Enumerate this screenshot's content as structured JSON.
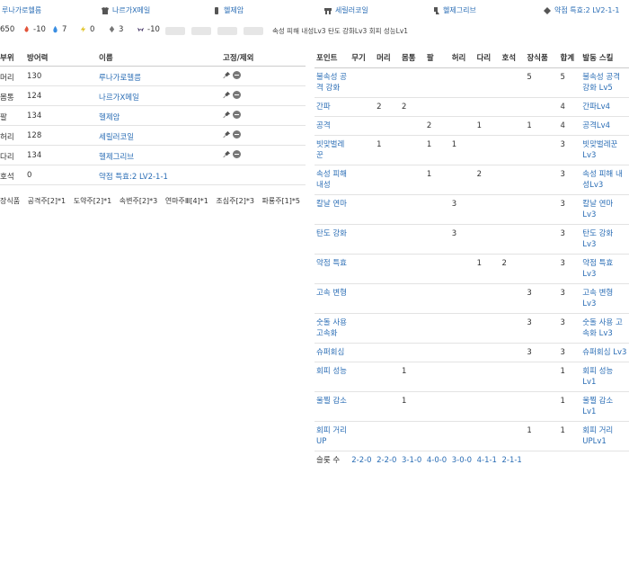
{
  "equipment": [
    {
      "icon": "helmet-icon",
      "name": "루나가로헬름"
    },
    {
      "icon": "chest-armor-icon",
      "name": "나르가X메일"
    },
    {
      "icon": "arm-guard-icon",
      "name": "헬제암"
    },
    {
      "icon": "waist-armor-icon",
      "name": "세릴러코일"
    },
    {
      "icon": "leg-armor-icon",
      "name": "헬제그리브"
    },
    {
      "icon": "charm-icon",
      "name": "약점 특효:2 LV2-1-1"
    }
  ],
  "stats": {
    "defense": "650",
    "fire": "-10",
    "water": "7",
    "thunder": "0",
    "ice": "3",
    "dragon": "-10"
  },
  "skills_summary": "속성 피해 내성Lv3  탄도 강화Lv3  회피 성능Lv1",
  "left_table": {
    "headers": {
      "part": "부위",
      "defense": "방어력",
      "name": "이름",
      "fix": "고정/제외"
    },
    "rows": [
      {
        "part": "머리",
        "defense": "130",
        "name": "루나가로헬름"
      },
      {
        "part": "몸통",
        "defense": "124",
        "name": "나르가X메일"
      },
      {
        "part": "팔",
        "defense": "134",
        "name": "헬제암"
      },
      {
        "part": "허리",
        "defense": "128",
        "name": "세릴러코일"
      },
      {
        "part": "다리",
        "defense": "134",
        "name": "헬제그리브"
      },
      {
        "part": "호석",
        "defense": "0",
        "name": "약점 특효:2 LV2-1-1"
      }
    ],
    "decorations_label": "장식품",
    "decorations": [
      "공격주[2]*1",
      "도약주[2]*1",
      "속변주[2]*3",
      "연마주Ⅲ[4]*1",
      "조심주[2]*3",
      "파룡주[1]*5"
    ]
  },
  "right_table": {
    "headers": [
      "포인트",
      "무기",
      "머리",
      "몸통",
      "팔",
      "허리",
      "다리",
      "호석",
      "장식품",
      "합계",
      "발동 스킬"
    ],
    "rows": [
      {
        "point": "불속성 공격 강화",
        "cells": [
          "",
          "",
          "",
          "",
          "",
          "",
          "",
          "5",
          "5"
        ],
        "skill": "불속성 공격 강화 Lv5"
      },
      {
        "point": "간파",
        "cells": [
          "",
          "2",
          "2",
          "",
          "",
          "",
          "",
          "",
          "4"
        ],
        "skill": "간파Lv4"
      },
      {
        "point": "공격",
        "cells": [
          "",
          "",
          "",
          "2",
          "",
          "1",
          "",
          "1",
          "4"
        ],
        "skill": "공격Lv4"
      },
      {
        "point": "빗맞벌레꾼",
        "cells": [
          "",
          "1",
          "",
          "1",
          "1",
          "",
          "",
          "",
          "3"
        ],
        "skill": "빗맞벌레꾼Lv3"
      },
      {
        "point": "속성 피해 내성",
        "cells": [
          "",
          "",
          "",
          "1",
          "",
          "2",
          "",
          "",
          "3"
        ],
        "skill": "속성 피해 내성Lv3"
      },
      {
        "point": "칼날 연마",
        "cells": [
          "",
          "",
          "",
          "",
          "3",
          "",
          "",
          "",
          "3"
        ],
        "skill": "칼날 연마 Lv3"
      },
      {
        "point": "탄도 강화",
        "cells": [
          "",
          "",
          "",
          "",
          "3",
          "",
          "",
          "",
          "3"
        ],
        "skill": "탄도 강화 Lv3"
      },
      {
        "point": "약점 특효",
        "cells": [
          "",
          "",
          "",
          "",
          "",
          "1",
          "2",
          "",
          "3"
        ],
        "skill": "약점 특효 Lv3"
      },
      {
        "point": "고속 변형",
        "cells": [
          "",
          "",
          "",
          "",
          "",
          "",
          "",
          "3",
          "3"
        ],
        "skill": "고속 변형 Lv3"
      },
      {
        "point": "숫돌 사용 고속화",
        "cells": [
          "",
          "",
          "",
          "",
          "",
          "",
          "",
          "3",
          "3"
        ],
        "skill": "숫돌 사용 고속화 Lv3"
      },
      {
        "point": "슈퍼회심",
        "cells": [
          "",
          "",
          "",
          "",
          "",
          "",
          "",
          "3",
          "3"
        ],
        "skill": "슈퍼회심 Lv3"
      },
      {
        "point": "회피 성능",
        "cells": [
          "",
          "",
          "1",
          "",
          "",
          "",
          "",
          "",
          "1"
        ],
        "skill": "회피 성능 Lv1"
      },
      {
        "point": "울찔 감소",
        "cells": [
          "",
          "",
          "1",
          "",
          "",
          "",
          "",
          "",
          "1"
        ],
        "skill": "울찔 감소 Lv1"
      },
      {
        "point": "회피 거리 UP",
        "cells": [
          "",
          "",
          "",
          "",
          "",
          "",
          "",
          "1",
          "1"
        ],
        "skill": "회피 거리 UPLv1"
      }
    ],
    "slots_label": "슬롯 수",
    "slots": [
      "2-2-0",
      "2-2-0",
      "3-1-0",
      "4-0-0",
      "3-0-0",
      "4-1-1",
      "2-1-1"
    ]
  }
}
